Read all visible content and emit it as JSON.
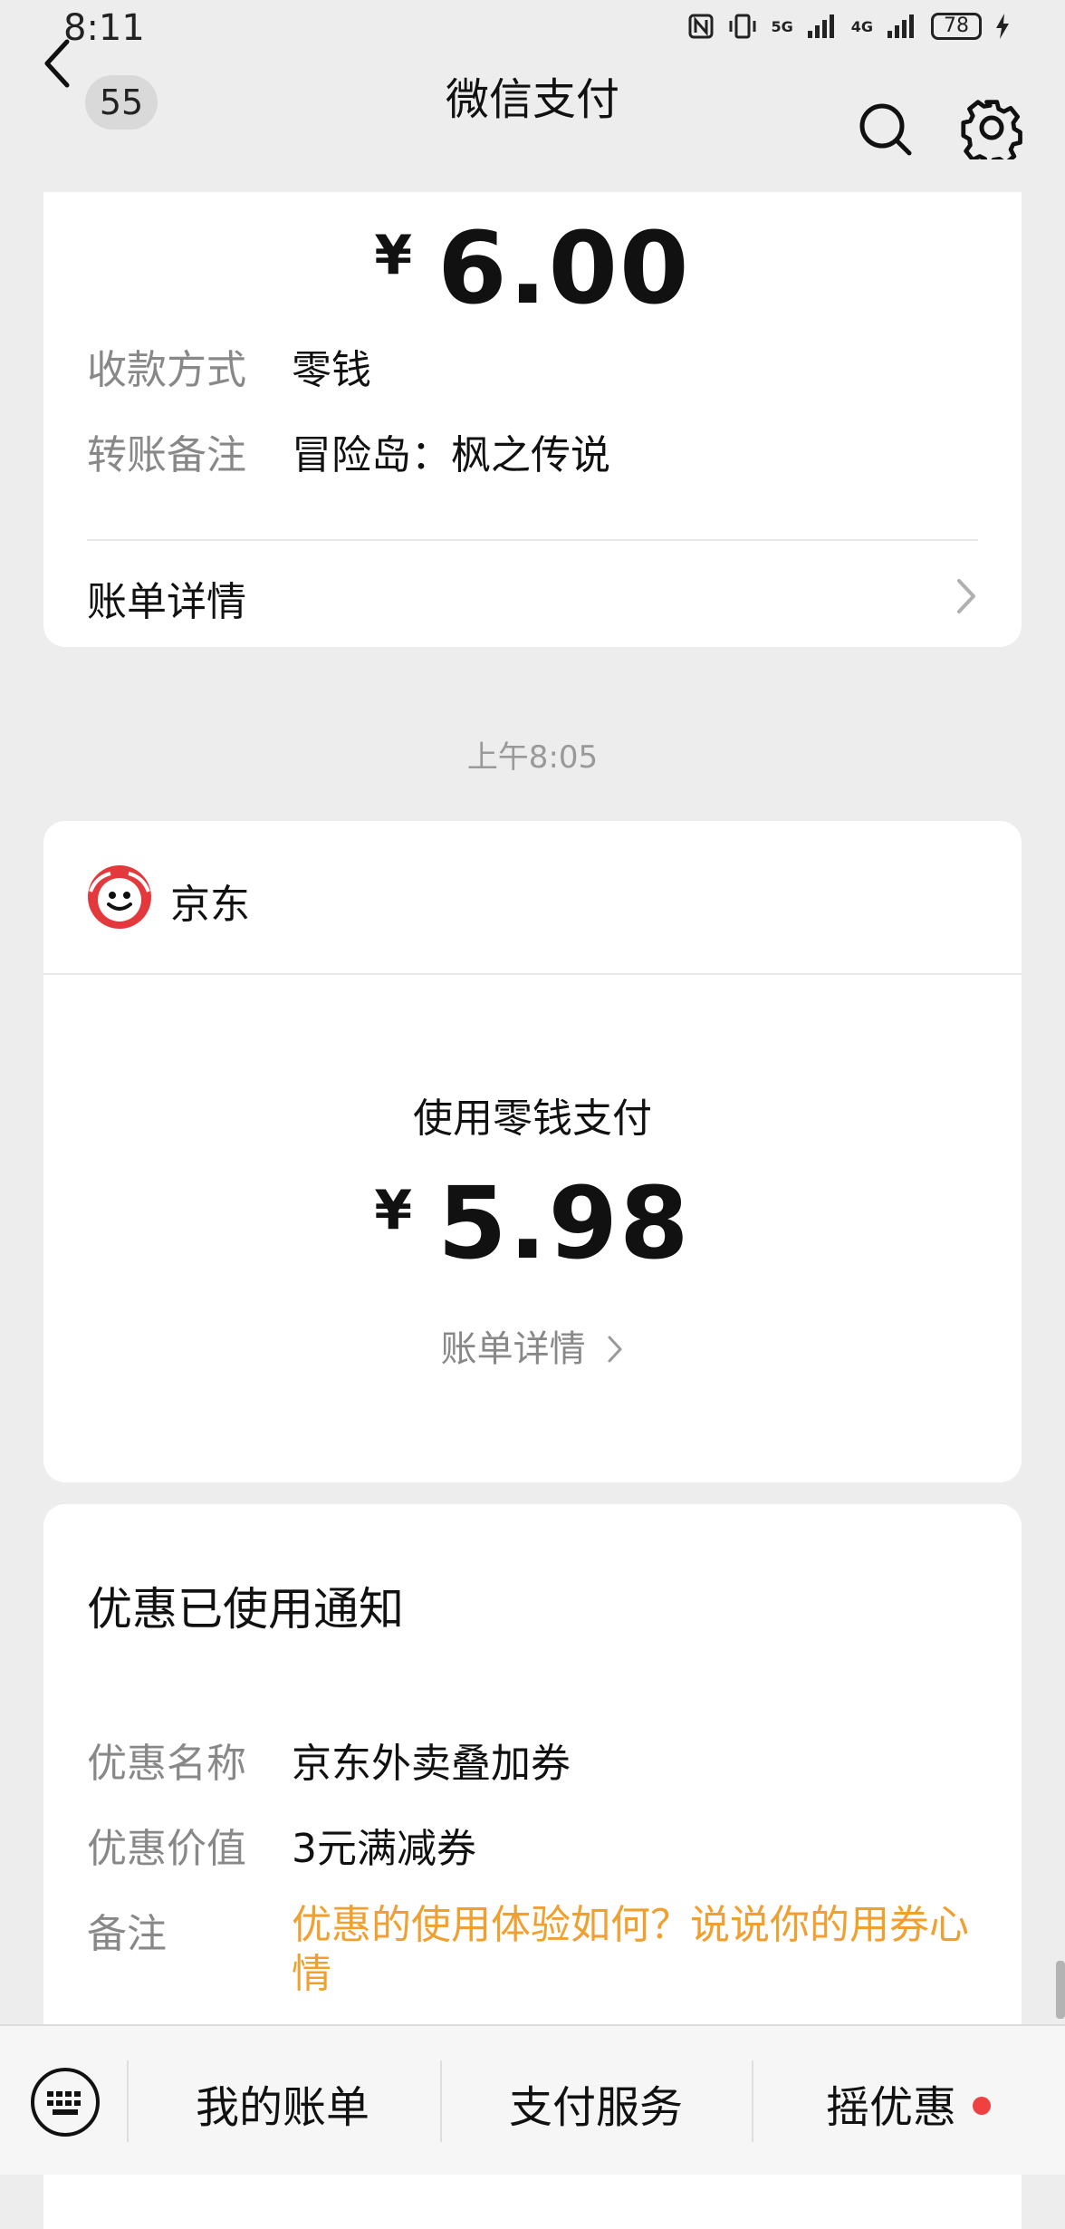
{
  "status_bar": {
    "time": "8:11",
    "battery": "78",
    "network_5g": "5G",
    "network_4g": "4G"
  },
  "nav": {
    "unread_count": "55",
    "title": "微信支付"
  },
  "message1": {
    "currency": "¥",
    "amount": "6.00",
    "rows": [
      {
        "label": "收款方式",
        "value": "零钱"
      },
      {
        "label": "转账备注",
        "value": "冒险岛：枫之传说"
      }
    ],
    "detail_label": "账单详情"
  },
  "timestamp": "上午8:05",
  "message2": {
    "merchant": "京东",
    "pay_method": "使用零钱支付",
    "currency": "¥",
    "amount": "5.98",
    "detail_label": "账单详情"
  },
  "message3": {
    "title": "优惠已使用通知",
    "rows": [
      {
        "label": "优惠名称",
        "value": "京东外卖叠加券"
      },
      {
        "label": "优惠价值",
        "value": "3元满减券"
      },
      {
        "label": "备注",
        "value": "优惠的使用体验如何？说说你的用券心情"
      }
    ]
  },
  "bottom_bar": {
    "items": [
      "我的账单",
      "支付服务",
      "摇优惠"
    ]
  },
  "colors": {
    "accent_orange": "#f0a030",
    "notification_red": "#f04142",
    "jd_red": "#e4393c"
  }
}
